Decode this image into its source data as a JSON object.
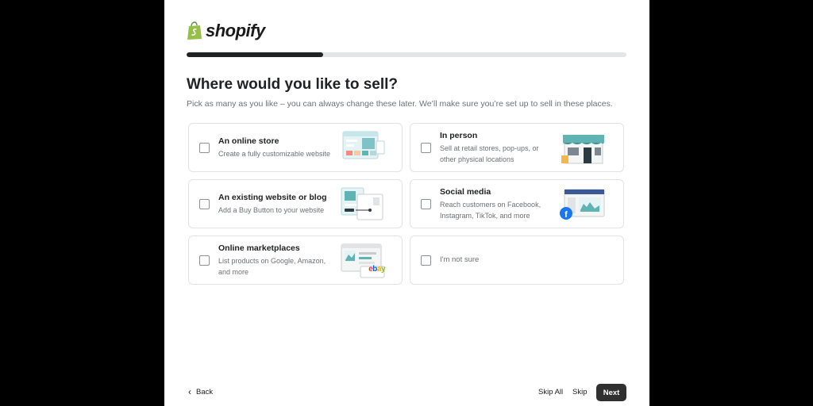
{
  "brand": {
    "name": "shopify",
    "logo_color": "#95bf47"
  },
  "progress": {
    "fraction": 0.31
  },
  "title": "Where would you like to sell?",
  "subtitle": "Pick as many as you like – you can always change these later. We’ll make sure you’re set up to sell in these places.",
  "options": [
    {
      "title": "An online store",
      "desc": "Create a fully customizable website",
      "icon": "online-store-illustration"
    },
    {
      "title": "In person",
      "desc": "Sell at retail stores, pop-ups, or other physical locations",
      "icon": "storefront-illustration"
    },
    {
      "title": "An existing website or blog",
      "desc": "Add a Buy Button to your website",
      "icon": "buy-button-illustration"
    },
    {
      "title": "Social media",
      "desc": "Reach customers on Facebook, Instagram, TikTok, and more",
      "icon": "social-media-illustration"
    },
    {
      "title": "Online marketplaces",
      "desc": "List products on Google, Amazon, and more",
      "icon": "marketplace-illustration",
      "badge": "ebay"
    },
    {
      "label": "I'm not sure"
    }
  ],
  "footer": {
    "back": "Back",
    "skip_all": "Skip All",
    "skip": "Skip",
    "next": "Next"
  }
}
